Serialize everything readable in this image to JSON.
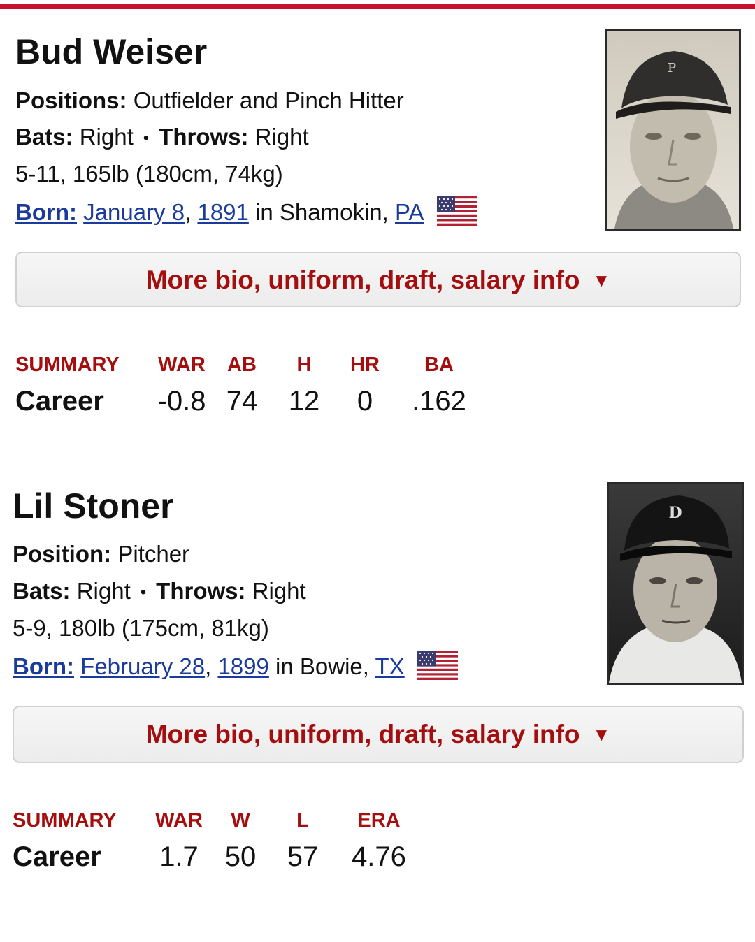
{
  "players": [
    {
      "name": "Bud Weiser",
      "positions_label": "Positions:",
      "positions_value": "Outfielder and Pinch Hitter",
      "bats_label": "Bats:",
      "bats_value": "Right",
      "throws_label": "Throws:",
      "throws_value": "Right",
      "separator": "•",
      "size": "5-11, 165lb (180cm, 74kg)",
      "born_label": "Born:",
      "born_date": "January 8",
      "born_year": "1891",
      "born_in": "in Shamokin,",
      "born_state": "PA",
      "more_info_label": "More bio, uniform, draft, salary info",
      "more_info_arrow": "▼",
      "summary": {
        "headers": [
          "SUMMARY",
          "WAR",
          "AB",
          "H",
          "HR",
          "BA"
        ],
        "row_label": "Career",
        "values": [
          "-0.8",
          "74",
          "12",
          "0",
          ".162"
        ]
      }
    },
    {
      "name": "Lil Stoner",
      "positions_label": "Position:",
      "positions_value": "Pitcher",
      "bats_label": "Bats:",
      "bats_value": "Right",
      "throws_label": "Throws:",
      "throws_value": "Right",
      "separator": "•",
      "size": "5-9, 180lb (175cm, 81kg)",
      "born_label": "Born:",
      "born_date": "February 28",
      "born_year": "1899",
      "born_in": "in Bowie,",
      "born_state": "TX",
      "more_info_label": "More bio, uniform, draft, salary info",
      "more_info_arrow": "▼",
      "summary": {
        "headers": [
          "SUMMARY",
          "WAR",
          "W",
          "L",
          "ERA"
        ],
        "row_label": "Career",
        "values": [
          "1.7",
          "50",
          "57",
          "4.76"
        ]
      }
    }
  ],
  "colors": {
    "accent_red": "#c8102e",
    "header_red": "#a50e0e",
    "link_blue": "#1a3a9c"
  }
}
